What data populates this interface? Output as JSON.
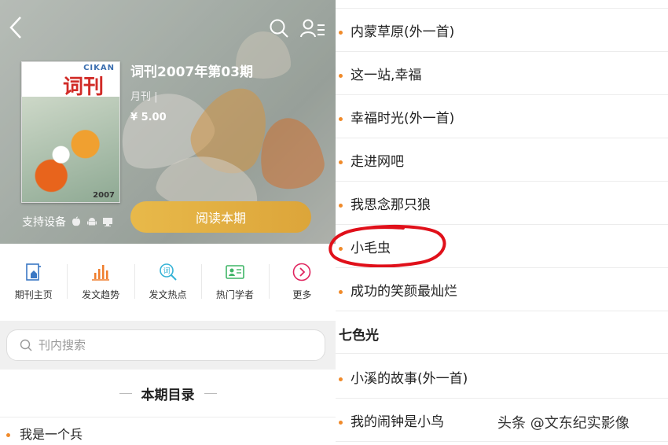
{
  "hero": {
    "title": "词刊2007年第03期",
    "frequency": "月刊 |",
    "price": "¥ 5.00",
    "devices_label": "支持设备",
    "read_button": "阅读本期",
    "cover_brand": "CIKAN",
    "cover_title": "词刊",
    "cover_year": "2007"
  },
  "toolbar": [
    {
      "label": "期刊主页",
      "icon": "journal-home-icon"
    },
    {
      "label": "发文趋势",
      "icon": "bar-chart-icon"
    },
    {
      "label": "发文热点",
      "icon": "hot-search-icon"
    },
    {
      "label": "热门学者",
      "icon": "id-card-icon"
    },
    {
      "label": "更多",
      "icon": "chevron-right-circle-icon"
    }
  ],
  "search": {
    "placeholder": "刊内搜索"
  },
  "toc": {
    "heading": "本期目录",
    "left_items": [
      "我是一个兵"
    ],
    "right_items": [
      "内蒙草原(外一首)",
      "这一站,幸福",
      "幸福时光(外一首)",
      "走进网吧",
      "我思念那只狼",
      "小毛虫",
      "成功的笑颜最灿烂"
    ],
    "section": "七色光",
    "section_items": [
      "小溪的故事(外一首)",
      "我的闹钟是小鸟"
    ]
  },
  "watermark": "头条 @文东纪实影像",
  "colors": {
    "accent": "#f08a2a",
    "read_button": "#e0ac40",
    "highlight_circle": "#e0101a"
  }
}
